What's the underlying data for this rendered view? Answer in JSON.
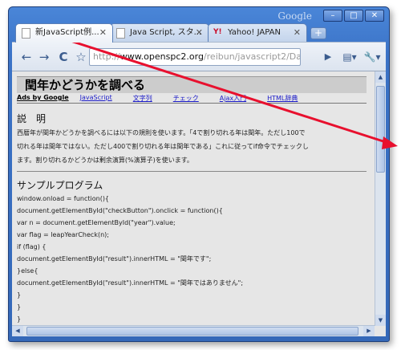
{
  "window": {
    "brand": "Google",
    "controls": [
      "–",
      "□",
      "✕"
    ]
  },
  "tabs": [
    {
      "title": "新JavaScript例...",
      "icon": "page-icon",
      "active": true
    },
    {
      "title": "Java Script, スタ...",
      "icon": "page-icon",
      "active": false
    },
    {
      "title": "Yahoo! JAPAN",
      "icon": "yahoo-icon",
      "active": false
    }
  ],
  "new_tab_label": "+",
  "toolbar": {
    "back": "←",
    "forward": "→",
    "reload": "C",
    "star": "☆",
    "omnibox": {
      "scheme": "http://",
      "host": "www.openspc2.org",
      "path": "/reibun/javascript2/Da"
    },
    "go": "▶",
    "page_menu": "▤▾",
    "tools_menu": "🔧▾"
  },
  "page": {
    "title": "閏年かどうかを調べる",
    "ads_label": "Ads by Google",
    "nav_links": [
      "JavaScript",
      "文字列",
      "チェック",
      "Ajax入門",
      "HTML辞典"
    ],
    "desc_heading": "説　明",
    "desc_lines": [
      "西暦年が閏年かどうかを調べるには以下の規則を使います。「4で割り切れる年は閏年。ただし100で",
      "切れる年は閏年ではない。ただし400で割り切れる年は閏年である」これに従ってif命令でチェックし",
      "ます。割り切れるかどうかは剰余演算(%演算子)を使います。"
    ],
    "sample_heading": "サンプルプログラム",
    "code_lines": [
      "window.onload = function(){",
      "document.getElementById(\"checkButton\").onclick = function(){",
      "var n = document.getElementById(\"year\").value;",
      "var flag = leapYearCheck(n);",
      "if (flag) {",
      "document.getElementById(\"result\").innerHTML = \"閏年です\";",
      "}else{",
      "document.getElementById(\"result\").innerHTML = \"閏年ではありません\";",
      "}",
      "}",
      "}"
    ]
  },
  "colors": {
    "frame": "#3b73c7",
    "annotation_arrow": "#e8102e",
    "link": "#1a1ac8"
  }
}
